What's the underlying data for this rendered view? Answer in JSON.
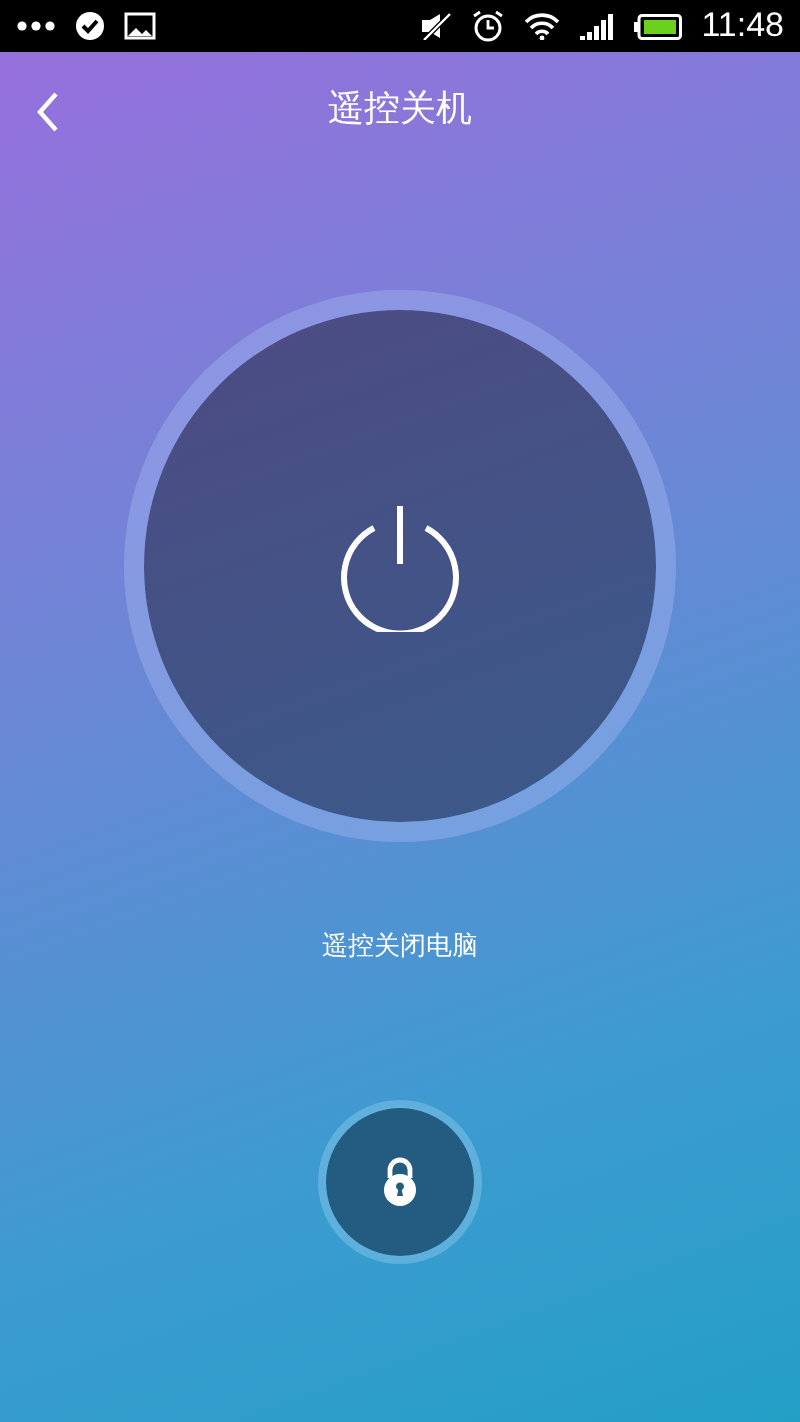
{
  "status_bar": {
    "time": "11:48"
  },
  "header": {
    "title": "遥控关机"
  },
  "power_caption": "遥控关闭电脑"
}
